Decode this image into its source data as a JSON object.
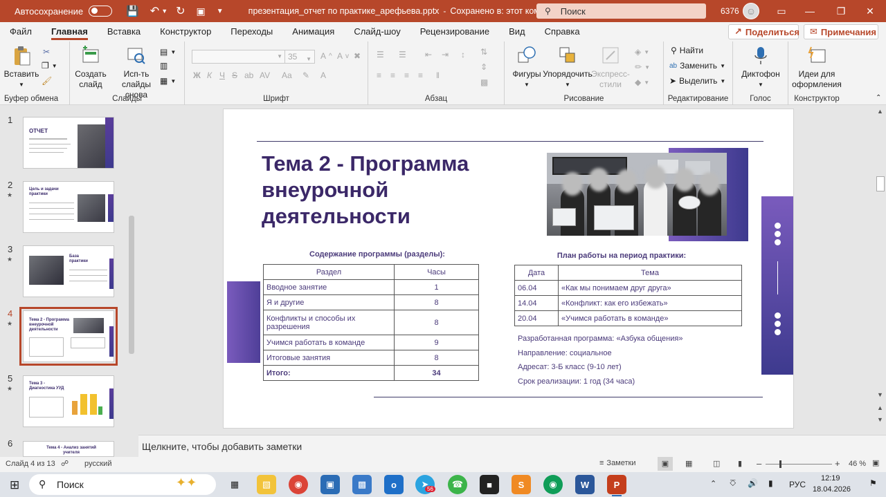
{
  "titlebar": {
    "autosave_label": "Автосохранение",
    "autosave_state": "Откл.",
    "doc_title": "презентация_отчет по практике_арефьева.pptx",
    "save_status": "Сохранено в: этот компьютер",
    "search_placeholder": "Поиск",
    "user_id": "6376",
    "accent": "#b7472a"
  },
  "tabs": [
    "Файл",
    "Главная",
    "Вставка",
    "Конструктор",
    "Переходы",
    "Анимация",
    "Слайд-шоу",
    "Рецензирование",
    "Вид",
    "Справка"
  ],
  "share_label": "Поделиться",
  "comments_label": "Примечания",
  "ribbon": {
    "clipboard": {
      "paste": "Вставить",
      "label": "Буфер обмена"
    },
    "slides": {
      "new_slide": "Создать слайд",
      "reuse": "Исп-ть слайды снова",
      "label": "Слайды"
    },
    "font": {
      "font_size": "35",
      "label": "Шрифт"
    },
    "paragraph": {
      "label": "Абзац"
    },
    "drawing": {
      "shapes": "Фигуры",
      "arrange": "Упорядочить",
      "quick_styles": "Экспресс-стили",
      "label": "Рисование"
    },
    "editing": {
      "find": "Найти",
      "replace": "Заменить",
      "select": "Выделить",
      "label": "Редактирование"
    },
    "voice": {
      "dictate": "Диктофон",
      "label": "Голос"
    },
    "designer": {
      "ideas": "Идеи для оформления",
      "label": "Конструктор"
    }
  },
  "thumbs": [
    {
      "num": "1",
      "title": "ОТЧЕТ",
      "star": false
    },
    {
      "num": "2",
      "title": "Цель и задачи практики",
      "star": true
    },
    {
      "num": "3",
      "title": "База практики",
      "star": true
    },
    {
      "num": "4",
      "title": "Тема 2 - Программа внеурочной деятельности",
      "star": true,
      "selected": true
    },
    {
      "num": "5",
      "title": "Тема 3 - Диагностика УУД",
      "star": true
    },
    {
      "num": "6",
      "title": "Тема 4 - Анализ занятий учителя",
      "star": false
    }
  ],
  "slide": {
    "title": "Тема 2 - Программа внеурочной деятельности",
    "program_caption": "Содержание программы (разделы):",
    "program_headers": [
      "Раздел",
      "Часы"
    ],
    "program_rows": [
      [
        "Вводное занятие",
        "1"
      ],
      [
        "Я и другие",
        "8"
      ],
      [
        "Конфликты и способы их разрешения",
        "8"
      ],
      [
        "Учимся работать в команде",
        "9"
      ],
      [
        "Итоговые занятия",
        "8"
      ],
      [
        "Итого:",
        "34"
      ]
    ],
    "plan_caption": "План работы на период практики:",
    "plan_headers": [
      "Дата",
      "Тема"
    ],
    "plan_rows": [
      [
        "06.04",
        "«Как мы понимаем друг друга»"
      ],
      [
        "14.04",
        "«Конфликт: как его избежать»"
      ],
      [
        "20.04",
        "«Учимся работать в команде»"
      ]
    ],
    "info": [
      "Разработанная программа: «Азбука общения»",
      "Направление: социальное",
      "Адресат: 3-Б класс (9-10 лет)",
      "Срок реализации: 1 год (34 часа)"
    ]
  },
  "notes_placeholder": "Щелкните, чтобы добавить заметки",
  "status": {
    "slide_info": "Слайд 4 из 13",
    "language": "русский",
    "notes_btn": "Заметки",
    "zoom": "46 %"
  },
  "taskbar": {
    "search": "Поиск",
    "telegram_badge": "56",
    "lang": "РУС",
    "time": "12:19",
    "date": "18.04.2026"
  }
}
